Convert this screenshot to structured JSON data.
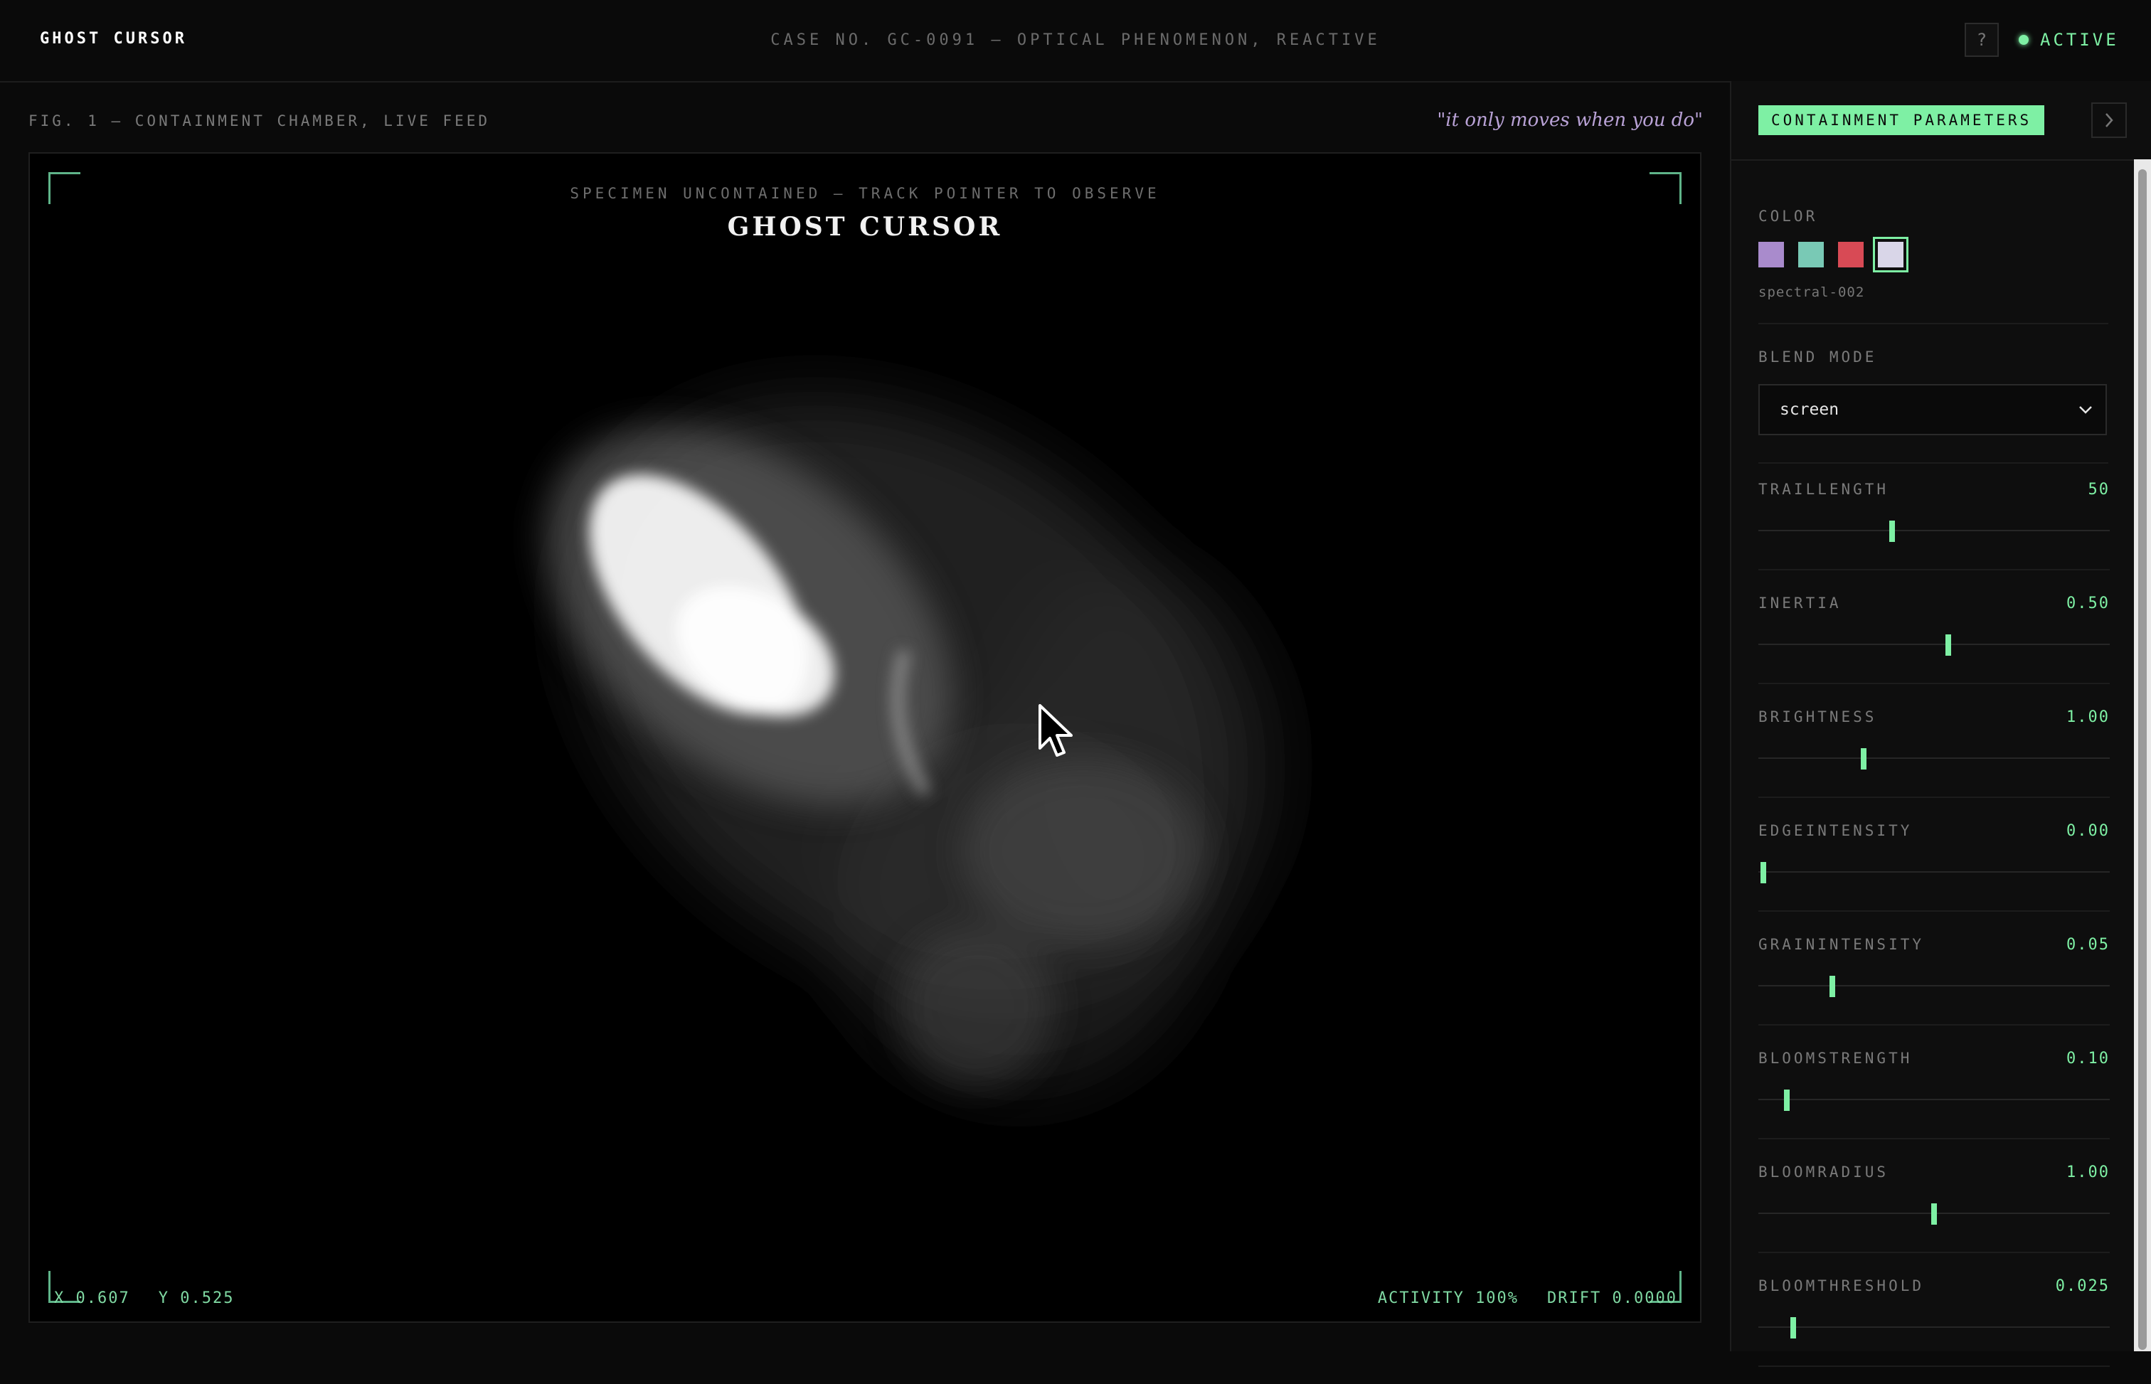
{
  "app": {
    "title": "GHOST CURSOR",
    "case": "CASE NO. GC-0091 — OPTICAL PHENOMENON, REACTIVE",
    "help_label": "?",
    "status": "ACTIVE",
    "status_color": "#7ef0a4"
  },
  "figure": {
    "label": "FIG. 1 — CONTAINMENT CHAMBER, LIVE FEED",
    "quote": "\"it only moves when you do\"",
    "subtitle": "SPECIMEN UNCONTAINED — TRACK POINTER TO OBSERVE",
    "title": "GHOST CURSOR"
  },
  "readout": {
    "x": "X 0.607",
    "y": "Y 0.525",
    "activity": "ACTIVITY 100%",
    "drift": "DRIFT 0.0000"
  },
  "panel": {
    "header": "CONTAINMENT PARAMETERS",
    "collapse_icon": "chevron-right-icon",
    "color_label": "COLOR",
    "swatches": [
      "#a98bcc",
      "#79c9b5",
      "#d84a55",
      "#d9d6e8"
    ],
    "selected_swatch_name": "spectral-002",
    "blend_label": "BLEND MODE",
    "blend_value": "screen",
    "blend_icon": "chevron-down-icon",
    "sliders": [
      {
        "label": "TRAILLENGTH",
        "value": "50",
        "fraction": 0.38
      },
      {
        "label": "INERTIA",
        "value": "0.50",
        "fraction": 0.54
      },
      {
        "label": "BRIGHTNESS",
        "value": "1.00",
        "fraction": 0.3
      },
      {
        "label": "EDGEINTENSITY",
        "value": "0.00",
        "fraction": 0.015
      },
      {
        "label": "GRAININTENSITY",
        "value": "0.05",
        "fraction": 0.21
      },
      {
        "label": "BLOOMSTRENGTH",
        "value": "0.10",
        "fraction": 0.08
      },
      {
        "label": "BLOOMRADIUS",
        "value": "1.00",
        "fraction": 0.5
      },
      {
        "label": "BLOOMTHRESHOLD",
        "value": "0.025",
        "fraction": 0.1
      }
    ]
  }
}
